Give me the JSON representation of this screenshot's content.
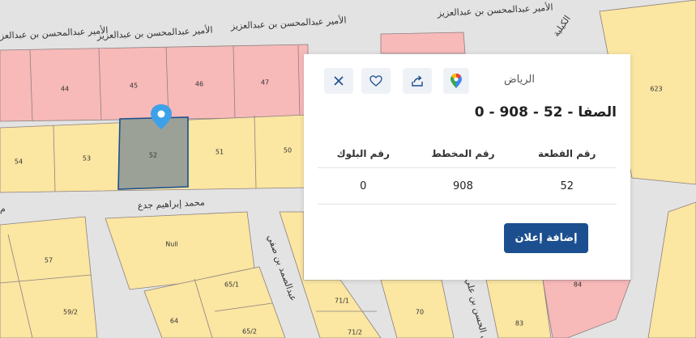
{
  "map": {
    "streets": [
      "الأمير عبدالمحسن بن عبدالعزيز",
      "الأمير عبدالمحسن بن عبدالعزيز",
      "الأمير عبدالمحسن بن عبدالعزيز",
      "الأمير عبدالمحسن بن عبدالعز",
      "الكيلية",
      "محمد إبراهيم جدع",
      "عبدالصمد بن صفي",
      "أبي الحسن بن علي",
      "م"
    ],
    "plots": [
      "44",
      "45",
      "46",
      "47",
      "623",
      "54",
      "53",
      "52",
      "51",
      "50",
      "Null",
      "57",
      "59/2",
      "64",
      "65/1",
      "65/2",
      "71/1",
      "71/2",
      "70",
      "83",
      "84"
    ],
    "colors": {
      "residential": "#fbe6a2",
      "commercial": "#f8b9b9",
      "selected": "#9ba196",
      "road": "#e3e3e3",
      "outline": "#8c7f7f"
    },
    "marker_icon": "location-pin-icon"
  },
  "card": {
    "city": "الرياض",
    "title": "الصفا - 52 - 908 - 0",
    "headers": [
      "رقم القطعة",
      "رقم المخطط",
      "رقم البلوك"
    ],
    "values": [
      "52",
      "908",
      "0"
    ],
    "add_ad_label": "إضافة إعلان",
    "icons": [
      "close-icon",
      "heart-icon",
      "share-icon",
      "google-maps-icon"
    ]
  }
}
